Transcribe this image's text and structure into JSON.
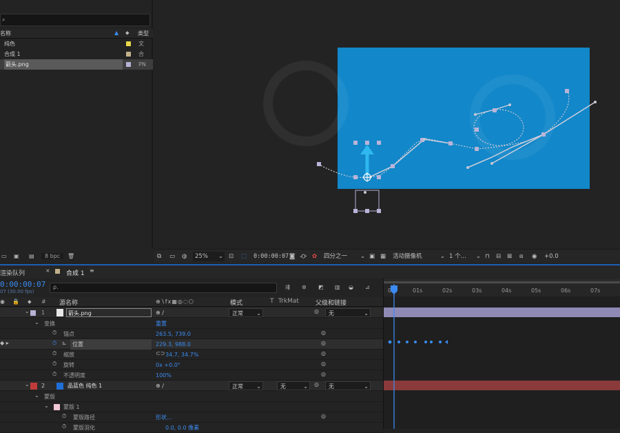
{
  "project": {
    "col_name": "名称",
    "col_type": "类型",
    "items": [
      {
        "name": "纯色",
        "type": "文",
        "color": "#e6d84a"
      },
      {
        "name": "合成 1",
        "type": "合",
        "color": "#c4b18a"
      },
      {
        "name": "箭头.png",
        "type": "PN",
        "color": "#b7b3d6"
      }
    ],
    "bpc": "8 bpc"
  },
  "viewer": {
    "comp_color": "#1287c9",
    "zoom": "25%",
    "timecode": "0:00:00:07",
    "resolution": "四分之一",
    "camera": "活动摄像机",
    "views": "1 个...",
    "exposure": "+0.0"
  },
  "timeline": {
    "tab_render": "渲染队列",
    "tab_comp": "合成 1",
    "current_time": "0:00:00:07",
    "fps_info": "07 (30.00 fps)",
    "search_placeholder": "ρ.",
    "headers": {
      "source_name": "源名称",
      "mode": "模式",
      "t": "T",
      "trkmat": "TrkMat",
      "parent": "父级和链接"
    },
    "ruler": [
      "0f",
      "01s",
      "02s",
      "03s",
      "04s",
      "05s",
      "06s",
      "07s"
    ],
    "layers": [
      {
        "num": "1",
        "name": "箭头.png",
        "color": "#b7b3d6",
        "mode": "正常",
        "parent": "无"
      },
      {
        "num": "2",
        "name": "品蓝色 纯色 1",
        "color": "#1f6fd6",
        "mode": "正常",
        "trkmat": "无",
        "parent": "无"
      }
    ],
    "transform": {
      "label": "变换",
      "reset": "重置",
      "anchor_label": "锚点",
      "anchor_value": "263.5, 739.0",
      "position_label": "位置",
      "position_value": "229.3, 988.0",
      "scale_label": "缩放",
      "scale_value": "34.7, 34.7%",
      "rotation_label": "旋转",
      "rotation_value": "0x +0.0°",
      "opacity_label": "不透明度",
      "opacity_value": "100%"
    },
    "masks": {
      "label": "蒙版",
      "mask1": "蒙版 1",
      "path_label": "蒙版路径",
      "path_value": "形状...",
      "feather_label": "蒙版羽化",
      "feather_value": "0.0, 0.0 像素"
    }
  }
}
